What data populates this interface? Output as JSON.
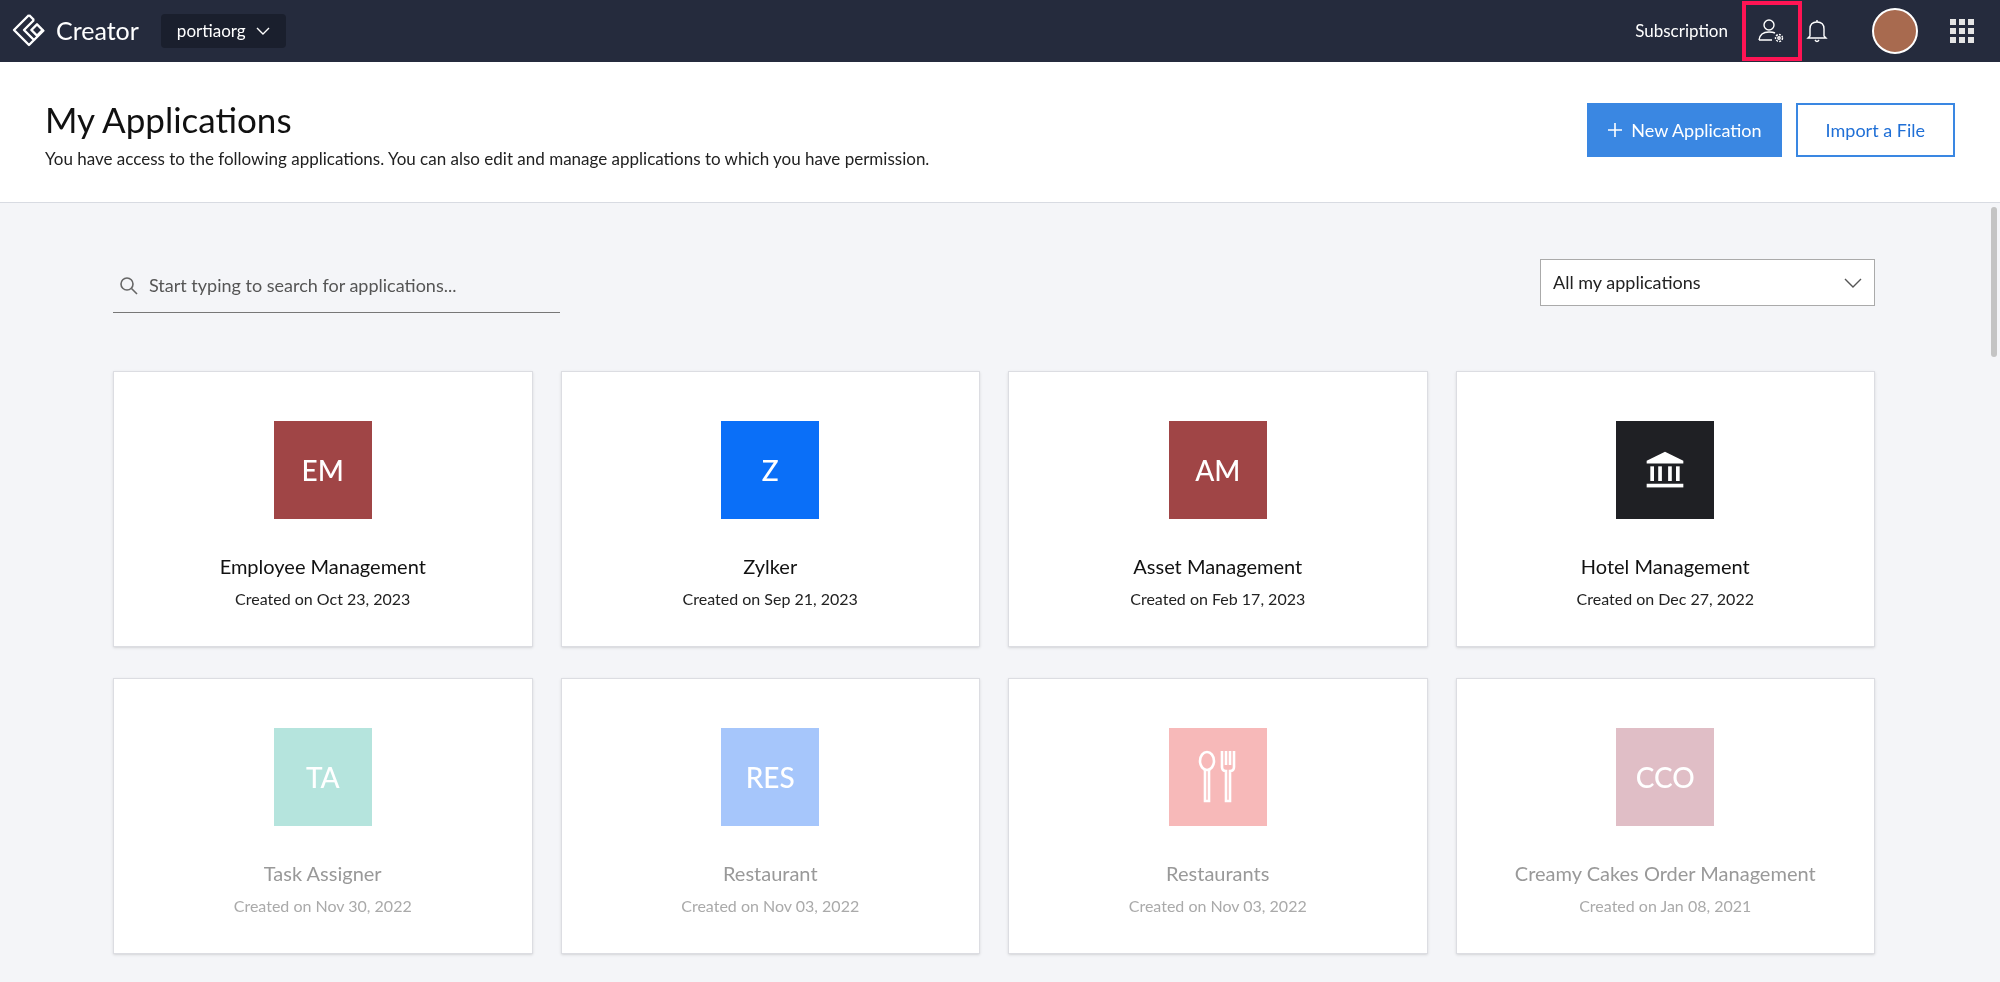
{
  "topbar": {
    "brand": "Creator",
    "org": "portiaorg",
    "subscription": "Subscription",
    "admin_highlighted": true
  },
  "header": {
    "title": "My Applications",
    "subtitle": "You have access to the following applications. You can also edit and manage applications to which you have permission.",
    "new_button": "New Application",
    "import_button": "Import a File"
  },
  "search": {
    "placeholder": "Start typing to search for applications..."
  },
  "filter": {
    "value": "All my applications"
  },
  "apps": [
    {
      "name": "Employee Management",
      "created": "Created on Oct 23, 2023",
      "kind": "initials",
      "initials": "EM",
      "color": "#a04546",
      "dimmed": false
    },
    {
      "name": "Zylker",
      "created": "Created on Sep 21, 2023",
      "kind": "initials",
      "initials": "Z",
      "color": "#0a6ff8",
      "dimmed": false
    },
    {
      "name": "Asset Management",
      "created": "Created on Feb 17, 2023",
      "kind": "initials",
      "initials": "AM",
      "color": "#a04546",
      "dimmed": false
    },
    {
      "name": "Hotel Management",
      "created": "Created on Dec 27, 2022",
      "kind": "bank",
      "color": "#1f2024",
      "dimmed": false
    },
    {
      "name": "Task Assigner",
      "created": "Created on Nov 30, 2022",
      "kind": "initials",
      "initials": "TA",
      "color": "#b5e4dd",
      "dimmed": true
    },
    {
      "name": "Restaurant",
      "created": "Created on Nov 03, 2022",
      "kind": "initials",
      "initials": "RES",
      "color": "#a6c6fb",
      "dimmed": true
    },
    {
      "name": "Restaurants",
      "created": "Created on Nov 03, 2022",
      "kind": "cutlery",
      "color": "#f7b9b9",
      "dimmed": true
    },
    {
      "name": "Creamy Cakes Order Management",
      "created": "Created on Jan 08, 2021",
      "kind": "initials",
      "initials": "CCO",
      "color": "#e0bec6",
      "dimmed": true
    }
  ]
}
